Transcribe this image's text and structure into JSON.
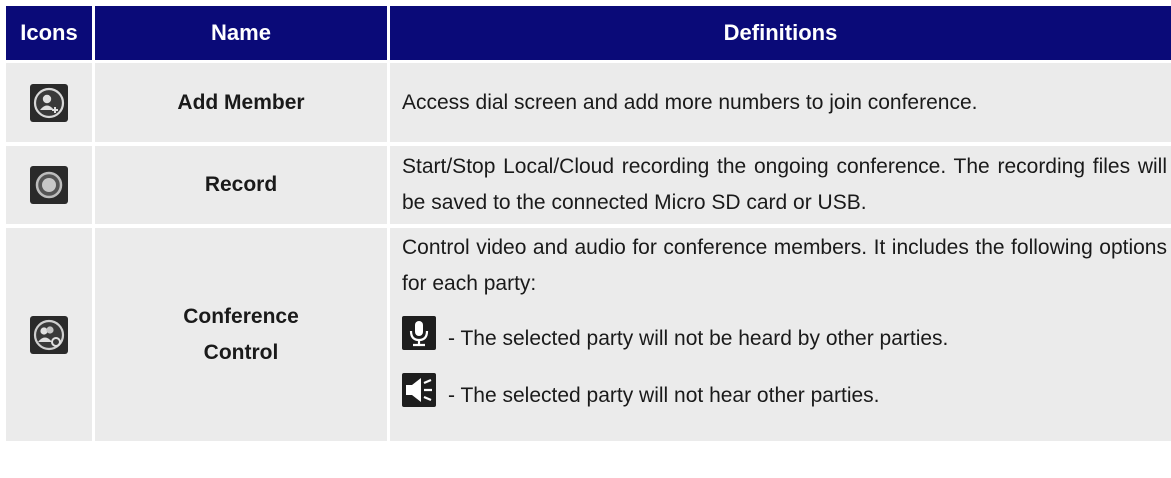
{
  "table": {
    "headers": {
      "icons": "Icons",
      "name": "Name",
      "definitions": "Definitions"
    },
    "rows": [
      {
        "icon": "add-member-icon",
        "name": "Add Member",
        "definition": "Access dial screen and add more numbers to join conference."
      },
      {
        "icon": "record-icon",
        "name": "Record",
        "definition": "Start/Stop Local/Cloud recording the ongoing conference. The recording files will be saved to the connected Micro SD card or USB."
      },
      {
        "icon": "conference-control-icon",
        "name_line1": "Conference",
        "name_line2": "Control",
        "definition": "Control video and audio for conference members. It includes the following options for each party:",
        "options": [
          {
            "icon": "microphone-icon",
            "text": " - The selected party will not be heard by other parties."
          },
          {
            "icon": "speaker-icon",
            "text": " - The selected party will not hear other parties."
          }
        ]
      }
    ]
  },
  "colors": {
    "header_bg": "#0a0a78",
    "header_text": "#ffffff",
    "row_bg": "#ebebeb"
  }
}
